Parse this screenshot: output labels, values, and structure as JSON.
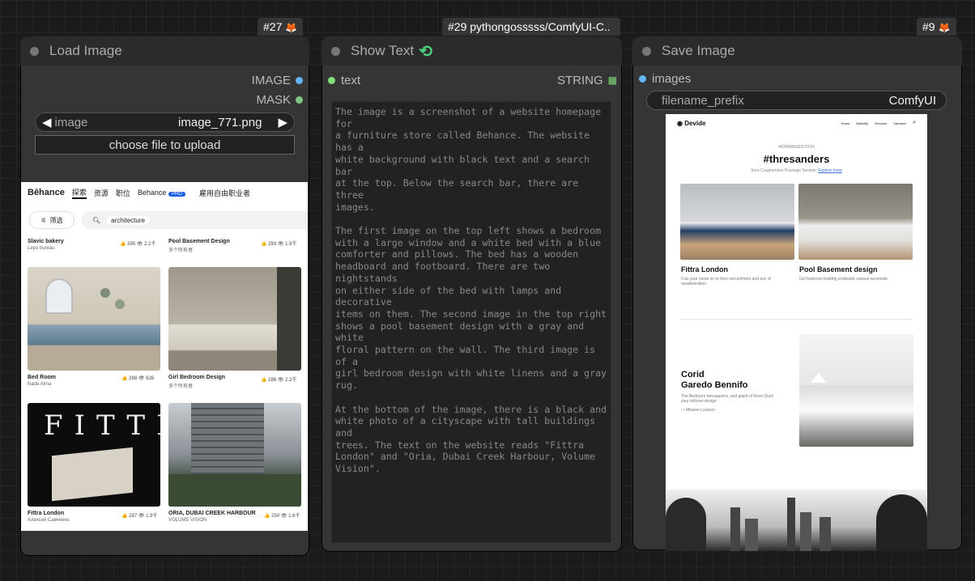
{
  "nodes": {
    "load_image": {
      "badge": "#27",
      "title": "Load Image",
      "outputs": [
        {
          "label": "IMAGE",
          "color": "#64b5f6"
        },
        {
          "label": "MASK",
          "color": "#81c784"
        }
      ],
      "image_widget": {
        "label": "image",
        "value": "image_771.png"
      },
      "upload_label": "choose file to upload",
      "preview": {
        "logo": "Bēhance",
        "nav": [
          "探索",
          "资源",
          "职位",
          "Behance",
          "雇用自由职业者"
        ],
        "pro": "PRO",
        "filter": "筛选",
        "search_chip": "architecture",
        "cards": [
          {
            "name": "Slavic bakery",
            "sub": "Lepo bureau",
            "likes": "395",
            "views": "2.1千"
          },
          {
            "name": "Pool Basement Design",
            "sub": "多个所有者",
            "likes": "293",
            "views": "1.9千"
          },
          {
            "name": "Bed Room",
            "sub": "Nada Alma",
            "likes": "288",
            "views": "626"
          },
          {
            "name": "Girl Bedroom Design",
            "sub": "多个所有者",
            "likes": "286",
            "views": "2.2千"
          },
          {
            "name": "Fittra London",
            "sub": "Алексей Савченко",
            "likes": "287",
            "views": "1.9千"
          },
          {
            "name": "ORIA, DUBAI CREEK HARBOUR",
            "sub": "VOLUME VISION",
            "likes": "250",
            "views": "1.6千"
          }
        ]
      }
    },
    "show_text": {
      "badge": "#29 pythongosssss/ComfyUI-C..",
      "title": "Show Text",
      "input_label": "text",
      "output_label": "STRING",
      "text": "The image is a screenshot of a website homepage for\na furniture store called Behance. The website has a\nwhite background with black text and a search bar\nat the top. Below the search bar, there are three\nimages.\n\nThe first image on the top left shows a bedroom\nwith a large window and a white bed with a blue\ncomforter and pillows. The bed has a wooden\nheadboard and footboard. There are two nightstands\non either side of the bed with lamps and decorative\nitems on them. The second image in the top right\nshows a pool basement design with a gray and white\nfloral pattern on the wall. The third image is of a\ngirl bedroom design with white linens and a gray\nrug.\n\nAt the bottom of the image, there is a black and\nwhite photo of a cityscape with tall buildings and\ntrees. The text on the website reads \"Fittra\nLondon\" and \"Oria, Dubai Creek Harbour, Volume\nVision\"."
    },
    "save_image": {
      "badge": "#9",
      "title": "Save Image",
      "input_label": "images",
      "prefix_widget": {
        "label": "filename_prefix",
        "value": "ComfyUI"
      },
      "preview": {
        "logo": "Devide",
        "nav": [
          "Home",
          "Butterfly",
          "Services",
          "Vibration"
        ],
        "eyebrow": "MORNINGEDITION",
        "heading": "#thresanders",
        "tagline": "Sera Cragmention Prastage Seramic",
        "tagline_link": "Explore more",
        "card1_title": "Fittra London",
        "card1_desc": "Fuis your meek on to then sell-amfirets and any of swadeleration.",
        "card2_title": "Pool Basement design",
        "card2_desc": "Girl bedroom buildng ersdeatte culeeur secensite.",
        "feature_title_1": "Corid",
        "feature_title_2": "Garedo Bennifo",
        "feature_desc": "The Bedroom hereasperts, and glaint of Nove Duzit your leftover design",
        "feature_author": "Mbaree Louisen"
      }
    }
  }
}
